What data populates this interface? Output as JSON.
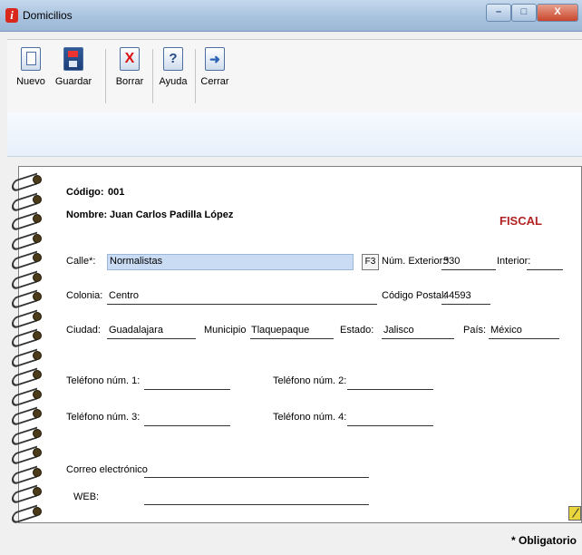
{
  "window": {
    "title": "Domicilios"
  },
  "toolbar": {
    "nuevo": "Nuevo",
    "guardar": "Guardar",
    "borrar": "Borrar",
    "ayuda": "Ayuda",
    "cerrar": "Cerrar"
  },
  "header": {
    "codigo_label": "Código:",
    "codigo": "001",
    "nombre_label": "Nombre:",
    "nombre": "Juan Carlos Padilla López",
    "tipo": "FISCAL"
  },
  "form": {
    "calle_label": "Calle*:",
    "calle": "Normalistas",
    "f3": "F3",
    "num_ext_label": "Núm. Exterior:*",
    "num_ext": "530",
    "interior_label": "Interior:",
    "interior": "",
    "colonia_label": "Colonia:",
    "colonia": "Centro",
    "cp_label": "Código Postal:",
    "cp": "44593",
    "ciudad_label": "Ciudad:",
    "ciudad": "Guadalajara",
    "municipio_label": "Municipio",
    "municipio": "Tlaquepaque",
    "estado_label": "Estado:",
    "estado": "Jalisco",
    "pais_label": "País:",
    "pais": "México",
    "tel1_label": "Teléfono núm. 1:",
    "tel2_label": "Teléfono núm. 2:",
    "tel3_label": "Teléfono núm. 3:",
    "tel4_label": "Teléfono núm. 4:",
    "correo_label": "Correo electrónico",
    "web_label": "WEB:"
  },
  "footer": {
    "note": "* Obligatorio"
  }
}
